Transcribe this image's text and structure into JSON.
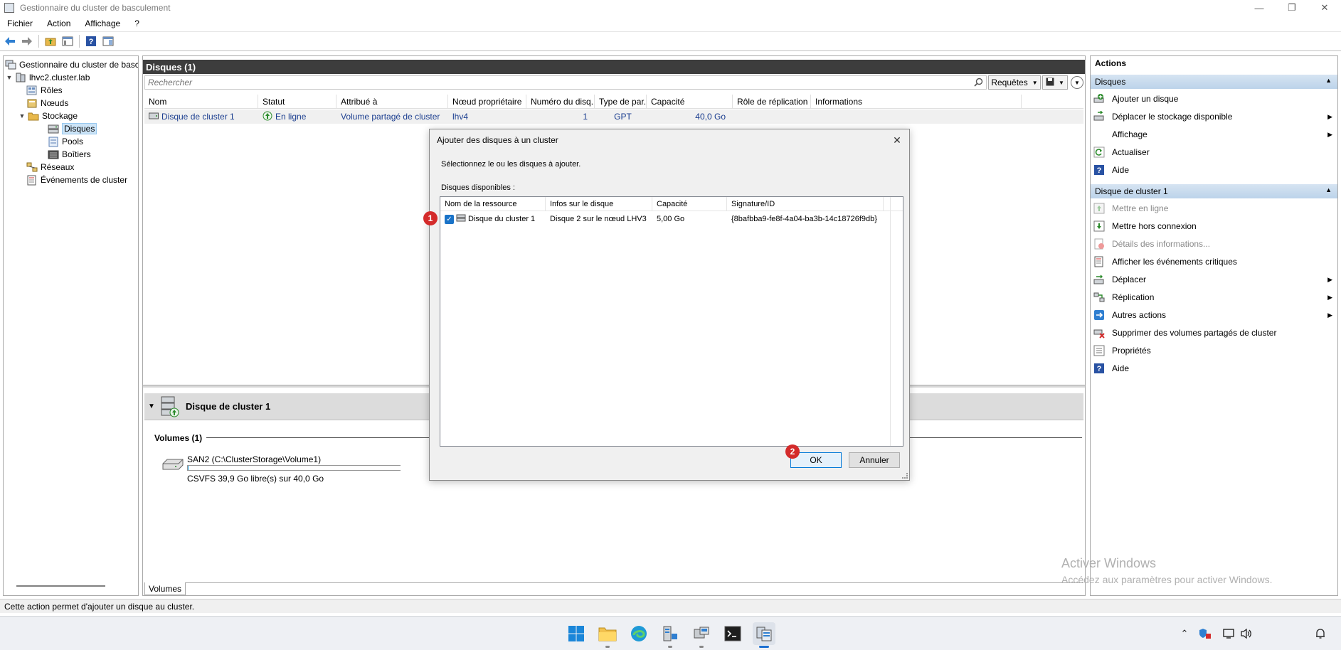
{
  "window": {
    "title": "Gestionnaire du cluster de basculement",
    "controls": [
      "minimize-icon",
      "restore-icon",
      "close-icon"
    ]
  },
  "menu": [
    "Fichier",
    "Action",
    "Affichage",
    "?"
  ],
  "toolbar": [
    "back-arrow-icon",
    "forward-arrow-icon",
    "folder-up-icon",
    "show-hide-tree-icon",
    "help-icon",
    "properties-pane-icon"
  ],
  "tree": {
    "root": "Gestionnaire du cluster de basc",
    "cluster": "lhvc2.cluster.lab",
    "roles": "Rôles",
    "nodes": "Nœuds",
    "storage": "Stockage",
    "disks": "Disques",
    "pools": "Pools",
    "enclosures": "Boîtiers",
    "networks": "Réseaux",
    "events": "Événements de cluster"
  },
  "center": {
    "header": "Disques (1)",
    "search_placeholder": "Rechercher",
    "queries_label": "Requêtes",
    "columns": [
      "Nom",
      "Statut",
      "Attribué à",
      "Nœud propriétaire",
      "Numéro du disq...",
      "Type de par...",
      "Capacité",
      "Rôle de réplication",
      "Informations"
    ],
    "row": {
      "name": "Disque de cluster 1",
      "status": "En ligne",
      "assigned": "Volume partagé de cluster",
      "owner": "lhv4",
      "disk_number": "1",
      "partition_type": "GPT",
      "capacity": "40,0 Go",
      "replication_role": "",
      "info": ""
    },
    "detail": {
      "title": "Disque de cluster 1",
      "volumes_label": "Volumes (1)",
      "volume_name": "SAN2 (C:\\ClusterStorage\\Volume1)",
      "volume_info": "CSVFS 39,9 Go libre(s) sur 40,0 Go",
      "volume_used_fraction": 0.0025
    },
    "bottom_tab": "Volumes"
  },
  "actions": {
    "title": "Actions",
    "section1": "Disques",
    "section1_items": [
      "Ajouter un disque",
      "Déplacer le stockage disponible",
      "Affichage",
      "Actualiser",
      "Aide"
    ],
    "section2": "Disque de cluster 1",
    "section2_items": [
      "Mettre en ligne",
      "Mettre hors connexion",
      "Détails des informations...",
      "Afficher les événements critiques",
      "Déplacer",
      "Réplication",
      "Autres actions",
      "Supprimer des volumes partagés de cluster",
      "Propriétés",
      "Aide"
    ]
  },
  "watermark": {
    "title": "Activer Windows",
    "subtitle": "Accédez aux paramètres pour activer Windows."
  },
  "status_bar": "Cette action permet d'ajouter un disque au cluster.",
  "dialog": {
    "title": "Ajouter des disques à un cluster",
    "instruction": "Sélectionnez le ou les disques à ajouter.",
    "available_label": "Disques disponibles :",
    "columns": [
      "Nom de la ressource",
      "Infos sur le disque",
      "Capacité",
      "Signature/ID"
    ],
    "row": {
      "checked": true,
      "name": "Disque du cluster 1",
      "info": "Disque 2 sur le nœud LHV3",
      "capacity": "5,00 Go",
      "signature": "{8bafbba9-fe8f-4a04-ba3b-14c18726f9db}"
    },
    "ok_label": "OK",
    "cancel_label": "Annuler"
  },
  "badges": [
    "1",
    "2"
  ],
  "taskbar": [
    "start-icon",
    "file-explorer-icon",
    "edge-icon",
    "server-manager-icon",
    "hyper-v-icon",
    "terminal-icon",
    "failover-cluster-icon"
  ],
  "tray": [
    "chevron-up-icon",
    "security-icon",
    "network-icon",
    "volume-icon",
    "notification-icon"
  ],
  "colors": {
    "header_dark": "#3d3d3d",
    "selection": "#cce4f7",
    "action_section": "#bcd3ea",
    "link_blue": "#1a3d8f",
    "badge_red": "#d42b2b",
    "checkbox_blue": "#1a73c8"
  }
}
